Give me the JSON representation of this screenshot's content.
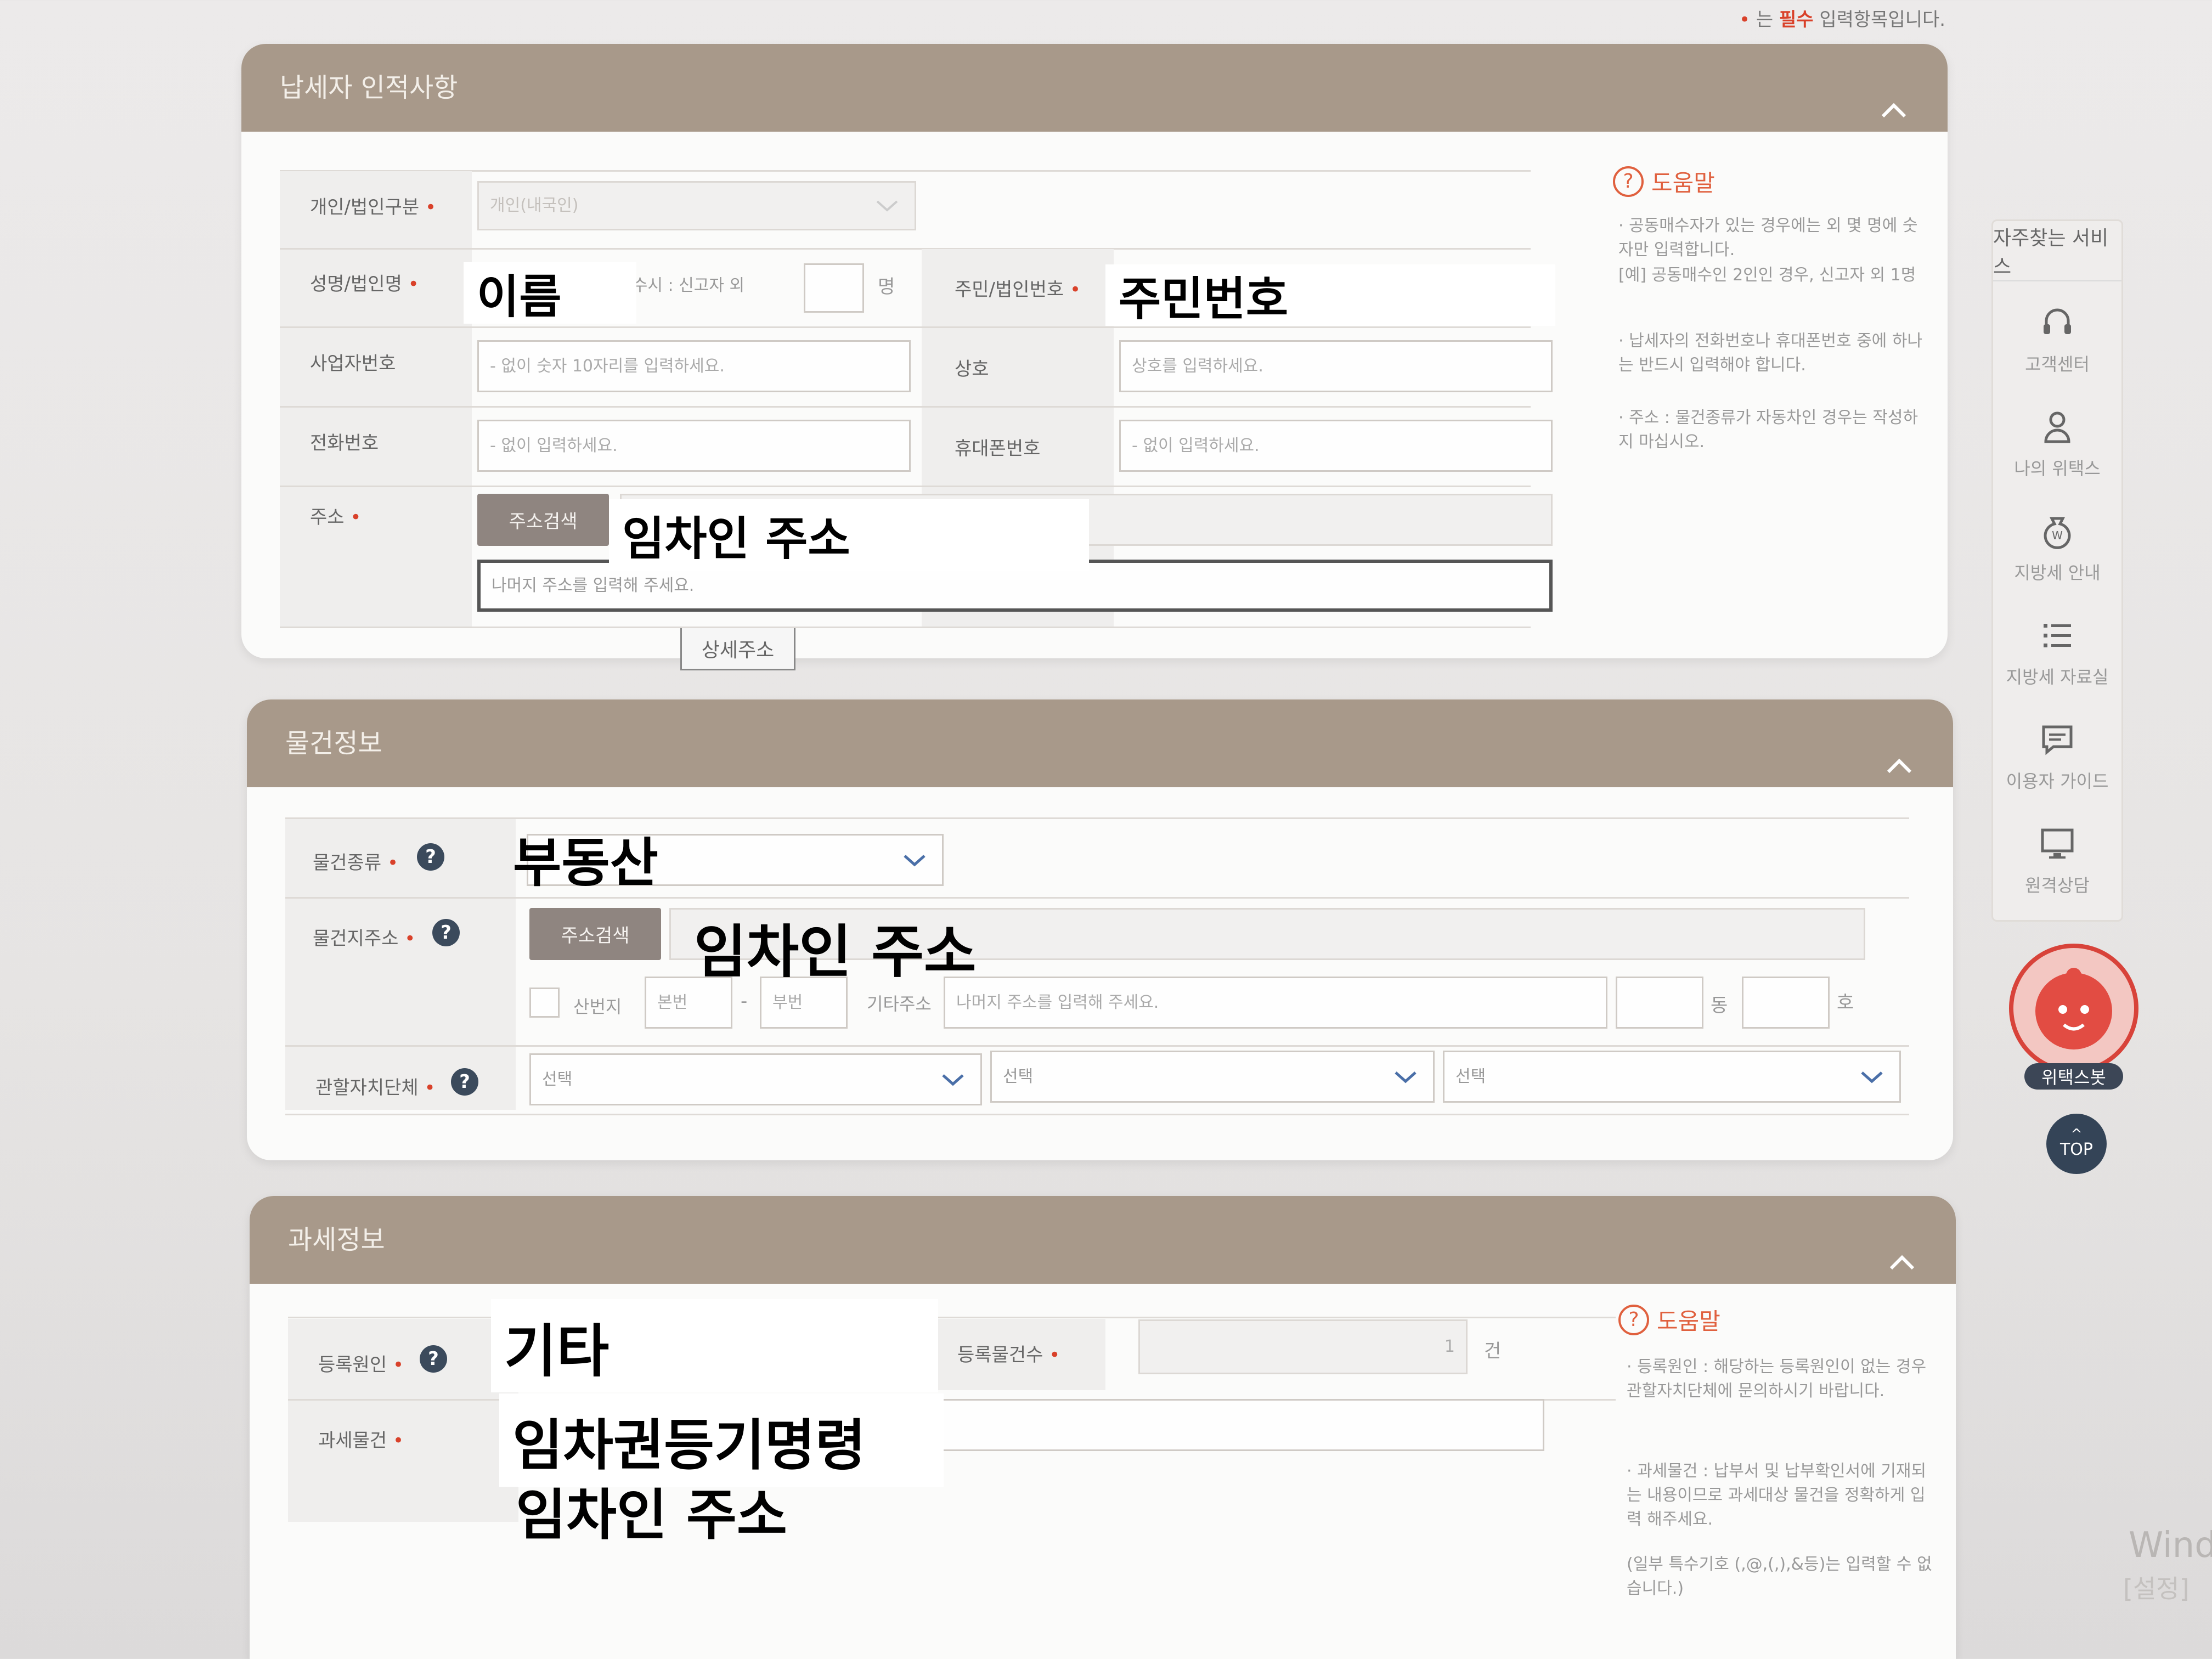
{
  "required_note": {
    "bullet": "•",
    "prefix": " 는 ",
    "emph": "필수",
    "suffix": " 입력항목입니다."
  },
  "taxpayer": {
    "header": "납세자 인적사항",
    "type_label": "개인/법인구분",
    "type_value": "개인(내국인)",
    "name_label": "성명/법인명",
    "name_overlay": "이름",
    "joint_text": "공동매수시 : 신고자 외",
    "joint_unit": "명",
    "rrn_label": "주민/법인번호",
    "rrn_overlay": "주민번호",
    "bizno_label": "사업자번호",
    "bizno_placeholder": "- 없이 숫자 10자리를 입력하세요.",
    "company_label": "상호",
    "company_placeholder": "상호를 입력하세요.",
    "phone_label": "전화번호",
    "phone_placeholder": "- 없이 입력하세요.",
    "mobile_label": "휴대폰번호",
    "mobile_placeholder": "- 없이 입력하세요.",
    "address_label": "주소",
    "address_search": "주소검색",
    "address_overlay": "임차인 주소",
    "address_detail_placeholder": "나머지 주소를 입력해 주세요.",
    "address_tooltip": "상세주소",
    "help_title": "도움말",
    "help_items": [
      "· 공동매수자가 있는 경우에는 외 몇 명에 숫자만 입력합니다.",
      "  [예] 공동매수인 2인인 경우, 신고자 외 1명",
      "· 납세자의 전화번호나 휴대폰번호 중에 하나는 반드시 입력해야 합니다.",
      "· 주소 : 물건종류가 자동차인 경우는 작성하지 마십시오."
    ]
  },
  "property": {
    "header": "물건정보",
    "kind_label": "물건종류",
    "kind_overlay": "부동산",
    "location_label": "물건지주소",
    "address_search": "주소검색",
    "address_overlay": "임차인 주소",
    "mountain_label": "산번지",
    "main_no_placeholder": "본번",
    "dash": "-",
    "sub_no_placeholder": "부번",
    "etc_label": "기타주소",
    "etc_placeholder": "나머지 주소를 입력해 주세요.",
    "dong_unit": "동",
    "ho_unit": "호",
    "authority_label": "관할자치단체",
    "select_1": "선택",
    "select_2": "선택",
    "select_3": "선택"
  },
  "tax": {
    "header": "과세정보",
    "cause_label": "등록원인",
    "cause_overlay": "기타",
    "count_label": "등록물건수",
    "count_value": "1",
    "count_unit": "건",
    "object_label": "과세물건",
    "object_overlay_1": "임차권등기명령",
    "object_overlay_2": "임차인 주소",
    "help_title": "도움말",
    "help_items": [
      "· 등록원인 : 해당하는 등록원인이 없는 경우 관할자치단체에 문의하시기 바랍니다.",
      "· 과세물건 : 납부서 및 납부확인서에 기재되는 내용이므로 과세대상 물건을 정확하게 입력 해주세요.",
      "  (일부 특수기호 (,@,(,),&등)는 입력할 수 없습니다.)"
    ]
  },
  "side": {
    "title": "자주찾는 서비스",
    "items": [
      {
        "label": "고객센터",
        "icon": "headset-icon"
      },
      {
        "label": "나의 위택스",
        "icon": "person-icon"
      },
      {
        "label": "지방세 안내",
        "icon": "money-bag-icon"
      },
      {
        "label": "지방세 자료실",
        "icon": "list-icon"
      },
      {
        "label": "이용자 가이드",
        "icon": "chat-icon"
      },
      {
        "label": "원격상담",
        "icon": "monitor-icon"
      }
    ],
    "mascot_label": "위택스봇",
    "top_label": "TOP"
  },
  "watermark": {
    "line1": "Wind",
    "line2": "[설정]"
  },
  "colors": {
    "header_bg": "#a8998a",
    "required": "#d9412a",
    "help": "#e0603e",
    "dark_btn": "#8f8580",
    "top_btn": "#344457"
  }
}
